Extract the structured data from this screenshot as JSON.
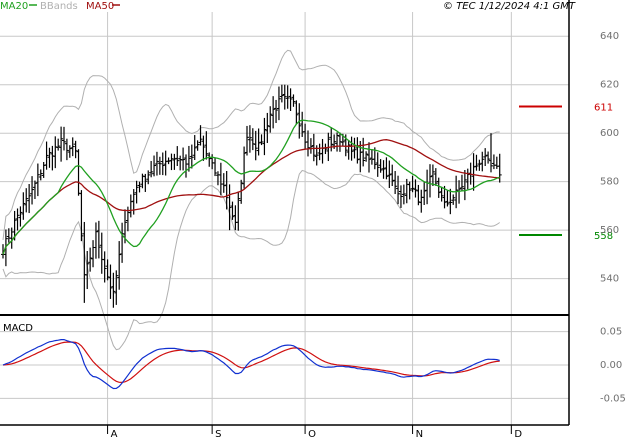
{
  "header": {
    "legend": [
      {
        "label": "MA20",
        "color": "#20a020"
      },
      {
        "label": "BBands",
        "color": "#b0b0b0"
      },
      {
        "label": "MA50",
        "color": "#a01010"
      }
    ],
    "copyright": "© TEC 1/12/2024 4:1 GMT"
  },
  "colors": {
    "background": "#ffffff",
    "grid": "#c8c8c8",
    "price": "#000000",
    "ma20": "#20a020",
    "bbands": "#b0b0b0",
    "ma50": "#a01010",
    "macd": "#1030d0",
    "signal": "#d01010",
    "resistance": "#cc0000",
    "support": "#008800"
  },
  "chart_data": [
    {
      "type": "candlestick",
      "x_labels": [
        {
          "label": "A",
          "index": 36
        },
        {
          "label": "S",
          "index": 72
        },
        {
          "label": "O",
          "index": 104
        },
        {
          "label": "N",
          "index": 141
        },
        {
          "label": "D",
          "index": 175
        }
      ],
      "n_periods": 190,
      "ylim": [
        525,
        650
      ],
      "y_ticks": [
        540,
        560,
        580,
        600,
        620,
        640
      ],
      "grid": true,
      "levels": [
        {
          "name": "resistance",
          "value": 611,
          "label": "611",
          "color": "#cc0000"
        },
        {
          "name": "support",
          "value": 558,
          "label": "558",
          "color": "#008800"
        }
      ],
      "anchors": [
        {
          "i": 0,
          "close": 552
        },
        {
          "i": 5,
          "close": 566
        },
        {
          "i": 10,
          "close": 576
        },
        {
          "i": 15,
          "close": 590
        },
        {
          "i": 20,
          "close": 596
        },
        {
          "i": 25,
          "close": 592
        },
        {
          "i": 28,
          "close": 540
        },
        {
          "i": 32,
          "close": 558
        },
        {
          "i": 35,
          "close": 545
        },
        {
          "i": 38,
          "close": 533
        },
        {
          "i": 42,
          "close": 565
        },
        {
          "i": 46,
          "close": 578
        },
        {
          "i": 52,
          "close": 586
        },
        {
          "i": 58,
          "close": 590
        },
        {
          "i": 64,
          "close": 588
        },
        {
          "i": 68,
          "close": 597
        },
        {
          "i": 72,
          "close": 586
        },
        {
          "i": 76,
          "close": 578
        },
        {
          "i": 80,
          "close": 562
        },
        {
          "i": 84,
          "close": 600
        },
        {
          "i": 88,
          "close": 594
        },
        {
          "i": 92,
          "close": 608
        },
        {
          "i": 96,
          "close": 614
        },
        {
          "i": 100,
          "close": 612
        },
        {
          "i": 104,
          "close": 598
        },
        {
          "i": 108,
          "close": 590
        },
        {
          "i": 112,
          "close": 596
        },
        {
          "i": 116,
          "close": 598
        },
        {
          "i": 120,
          "close": 592
        },
        {
          "i": 124,
          "close": 590
        },
        {
          "i": 128,
          "close": 588
        },
        {
          "i": 132,
          "close": 584
        },
        {
          "i": 136,
          "close": 575
        },
        {
          "i": 140,
          "close": 578
        },
        {
          "i": 144,
          "close": 572
        },
        {
          "i": 148,
          "close": 583
        },
        {
          "i": 152,
          "close": 570
        },
        {
          "i": 156,
          "close": 575
        },
        {
          "i": 160,
          "close": 582
        },
        {
          "i": 165,
          "close": 590
        },
        {
          "i": 168,
          "close": 586
        },
        {
          "i": 171,
          "close": 584
        }
      ],
      "n_bars": 172,
      "ma20_period": 20,
      "ma50_period": 50,
      "bb_period": 20,
      "bb_width_sd": 2
    },
    {
      "type": "line",
      "title": "MACD",
      "ylim": [
        -0.09,
        0.075
      ],
      "y_ticks": [
        {
          "value": 0.05,
          "label": "0.05"
        },
        {
          "value": 0.0,
          "label": "0.00"
        },
        {
          "value": -0.05,
          "label": "-0.05"
        }
      ],
      "series": [
        {
          "name": "MACD",
          "color": "#1030d0"
        },
        {
          "name": "Signal",
          "color": "#d01010"
        }
      ]
    }
  ]
}
